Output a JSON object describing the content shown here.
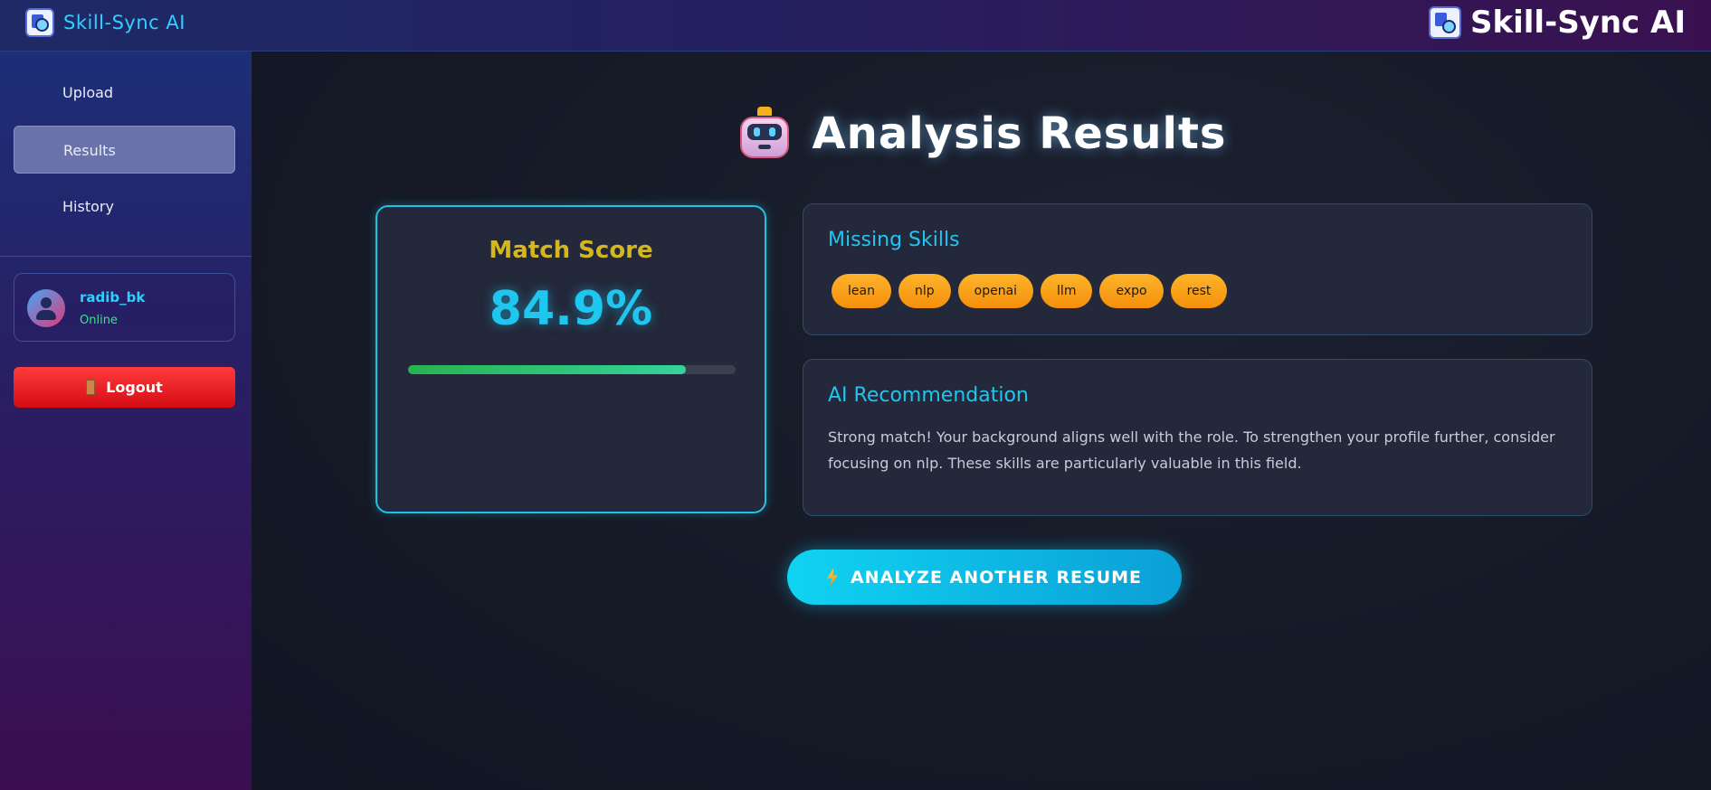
{
  "app": {
    "brand": "Skill-Sync AI"
  },
  "sidebar": {
    "items": [
      {
        "label": "Upload",
        "active": false
      },
      {
        "label": "Results",
        "active": true
      },
      {
        "label": "History",
        "active": false
      }
    ],
    "user": {
      "name": "radib_bk",
      "status": "Online"
    },
    "logout_label": "Logout"
  },
  "main": {
    "title": "Analysis Results",
    "score_card": {
      "label": "Match Score",
      "value": "84.9%",
      "progress_fraction": 0.849
    },
    "missing_skills": {
      "title": "Missing Skills",
      "skills": [
        "lean",
        "nlp",
        "openai",
        "llm",
        "expo",
        "rest"
      ]
    },
    "recommendation": {
      "title": "AI Recommendation",
      "text": "Strong match! Your background aligns well with the role. To strengthen your profile further, consider focusing on nlp. These skills are particularly valuable in this field."
    },
    "cta_label": "ANALYZE ANOTHER RESUME"
  },
  "colors": {
    "accent": "#1fc6f0",
    "score_label": "#d4b71f",
    "chip": "#f9a41c",
    "logout": "#e5151f",
    "online": "#3fe08a",
    "progress": "#2ec27a"
  },
  "icons": {
    "brand": "resume-search-icon",
    "title": "robot-icon",
    "logout": "door-icon",
    "cta": "lightning-icon",
    "avatar": "user-avatar-icon"
  }
}
